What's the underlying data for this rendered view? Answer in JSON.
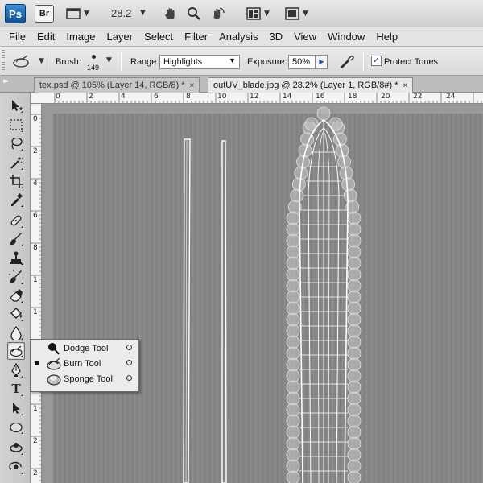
{
  "appbar": {
    "logo": "Ps",
    "bridge": "Br",
    "zoom": "28.2",
    "icons": [
      "screen-mode-icon",
      "hand-icon",
      "zoom-icon",
      "rotate-view-icon",
      "arrange-documents-icon",
      "screen-mode-icon"
    ]
  },
  "menu": [
    "File",
    "Edit",
    "Image",
    "Layer",
    "Select",
    "Filter",
    "Analysis",
    "3D",
    "View",
    "Window",
    "Help"
  ],
  "options": {
    "brush_label": "Brush:",
    "brush_size": "149",
    "range_label": "Range:",
    "range_value": "Highlights",
    "exposure_label": "Exposure:",
    "exposure_value": "50%",
    "protect_label": "Protect Tones",
    "protect_checked": "✓"
  },
  "tabs": [
    {
      "label": "tex.psd @ 105% (Layer 14, RGB/8) *",
      "close": "×"
    },
    {
      "label": "outUV_blade.jpg @ 28.2% (Layer 1, RGB/8#) *",
      "close": "×"
    }
  ],
  "hruler": [
    "0",
    "2",
    "4",
    "6",
    "8",
    "10",
    "12",
    "14",
    "16",
    "18",
    "20",
    "22",
    "24"
  ],
  "vruler": [
    "0",
    "2",
    "4",
    "6",
    "8",
    "1",
    "1",
    "1",
    "1",
    "1",
    "2",
    "2",
    "2"
  ],
  "flyout": [
    {
      "label": "Dodge Tool",
      "icon": "dodge-icon"
    },
    {
      "label": "Burn Tool",
      "icon": "burn-icon"
    },
    {
      "label": "Sponge Tool",
      "icon": "sponge-icon"
    }
  ],
  "colors": {
    "accent": "#1f5fa8",
    "canvas_bg": "#8a8a8a",
    "wire": "#ffffff"
  }
}
